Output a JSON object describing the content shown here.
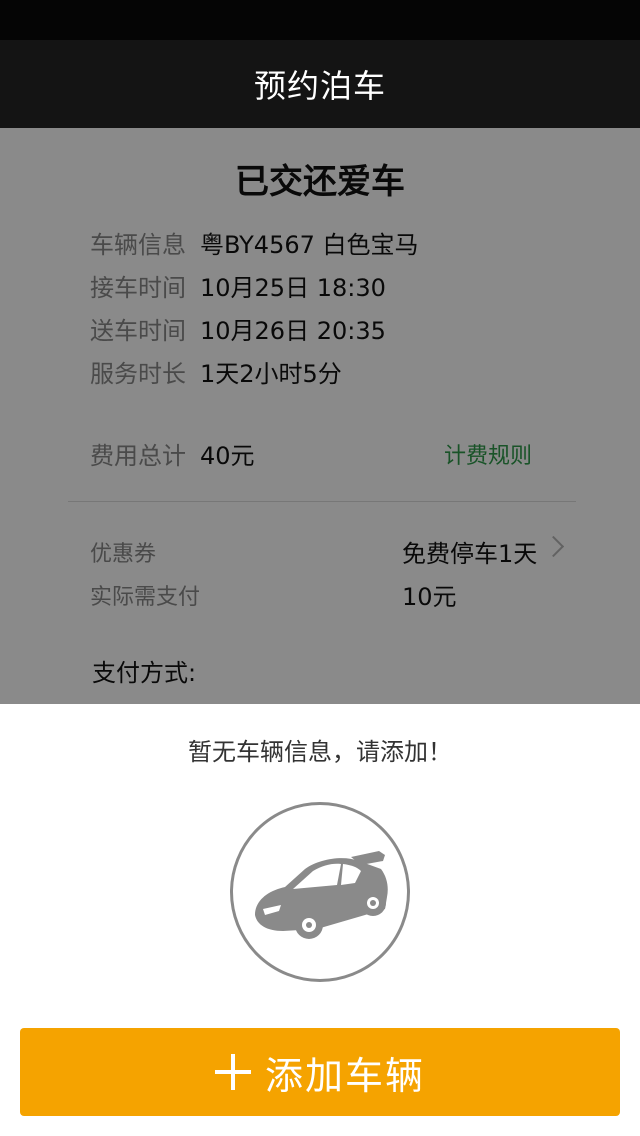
{
  "nav": {
    "title": "预约泊车"
  },
  "card": {
    "title": "已交还爱车",
    "info": [
      {
        "label": "车辆信息",
        "value": "粤BY4567 白色宝马"
      },
      {
        "label": "接车时间",
        "value": "10月25日 18:30"
      },
      {
        "label": "送车时间",
        "value": "10月26日 20:35"
      },
      {
        "label": "服务时长",
        "value": "1天2小时5分"
      }
    ],
    "fee": {
      "label": "费用总计",
      "value": "40元",
      "rule_link": "计费规则"
    },
    "coupon": {
      "label": "优惠券",
      "value": "免费停车1天"
    },
    "payable": {
      "label": "实际需支付",
      "value": "10元"
    },
    "payment_method_label": "支付方式:"
  },
  "sheet": {
    "message": "暂无车辆信息，请添加！",
    "car_icon": "car-icon",
    "add_button": "添加车辆"
  },
  "colors": {
    "accent_orange": "#f5a300",
    "link_green": "#2f9a4a",
    "nav_bg": "#141414"
  }
}
